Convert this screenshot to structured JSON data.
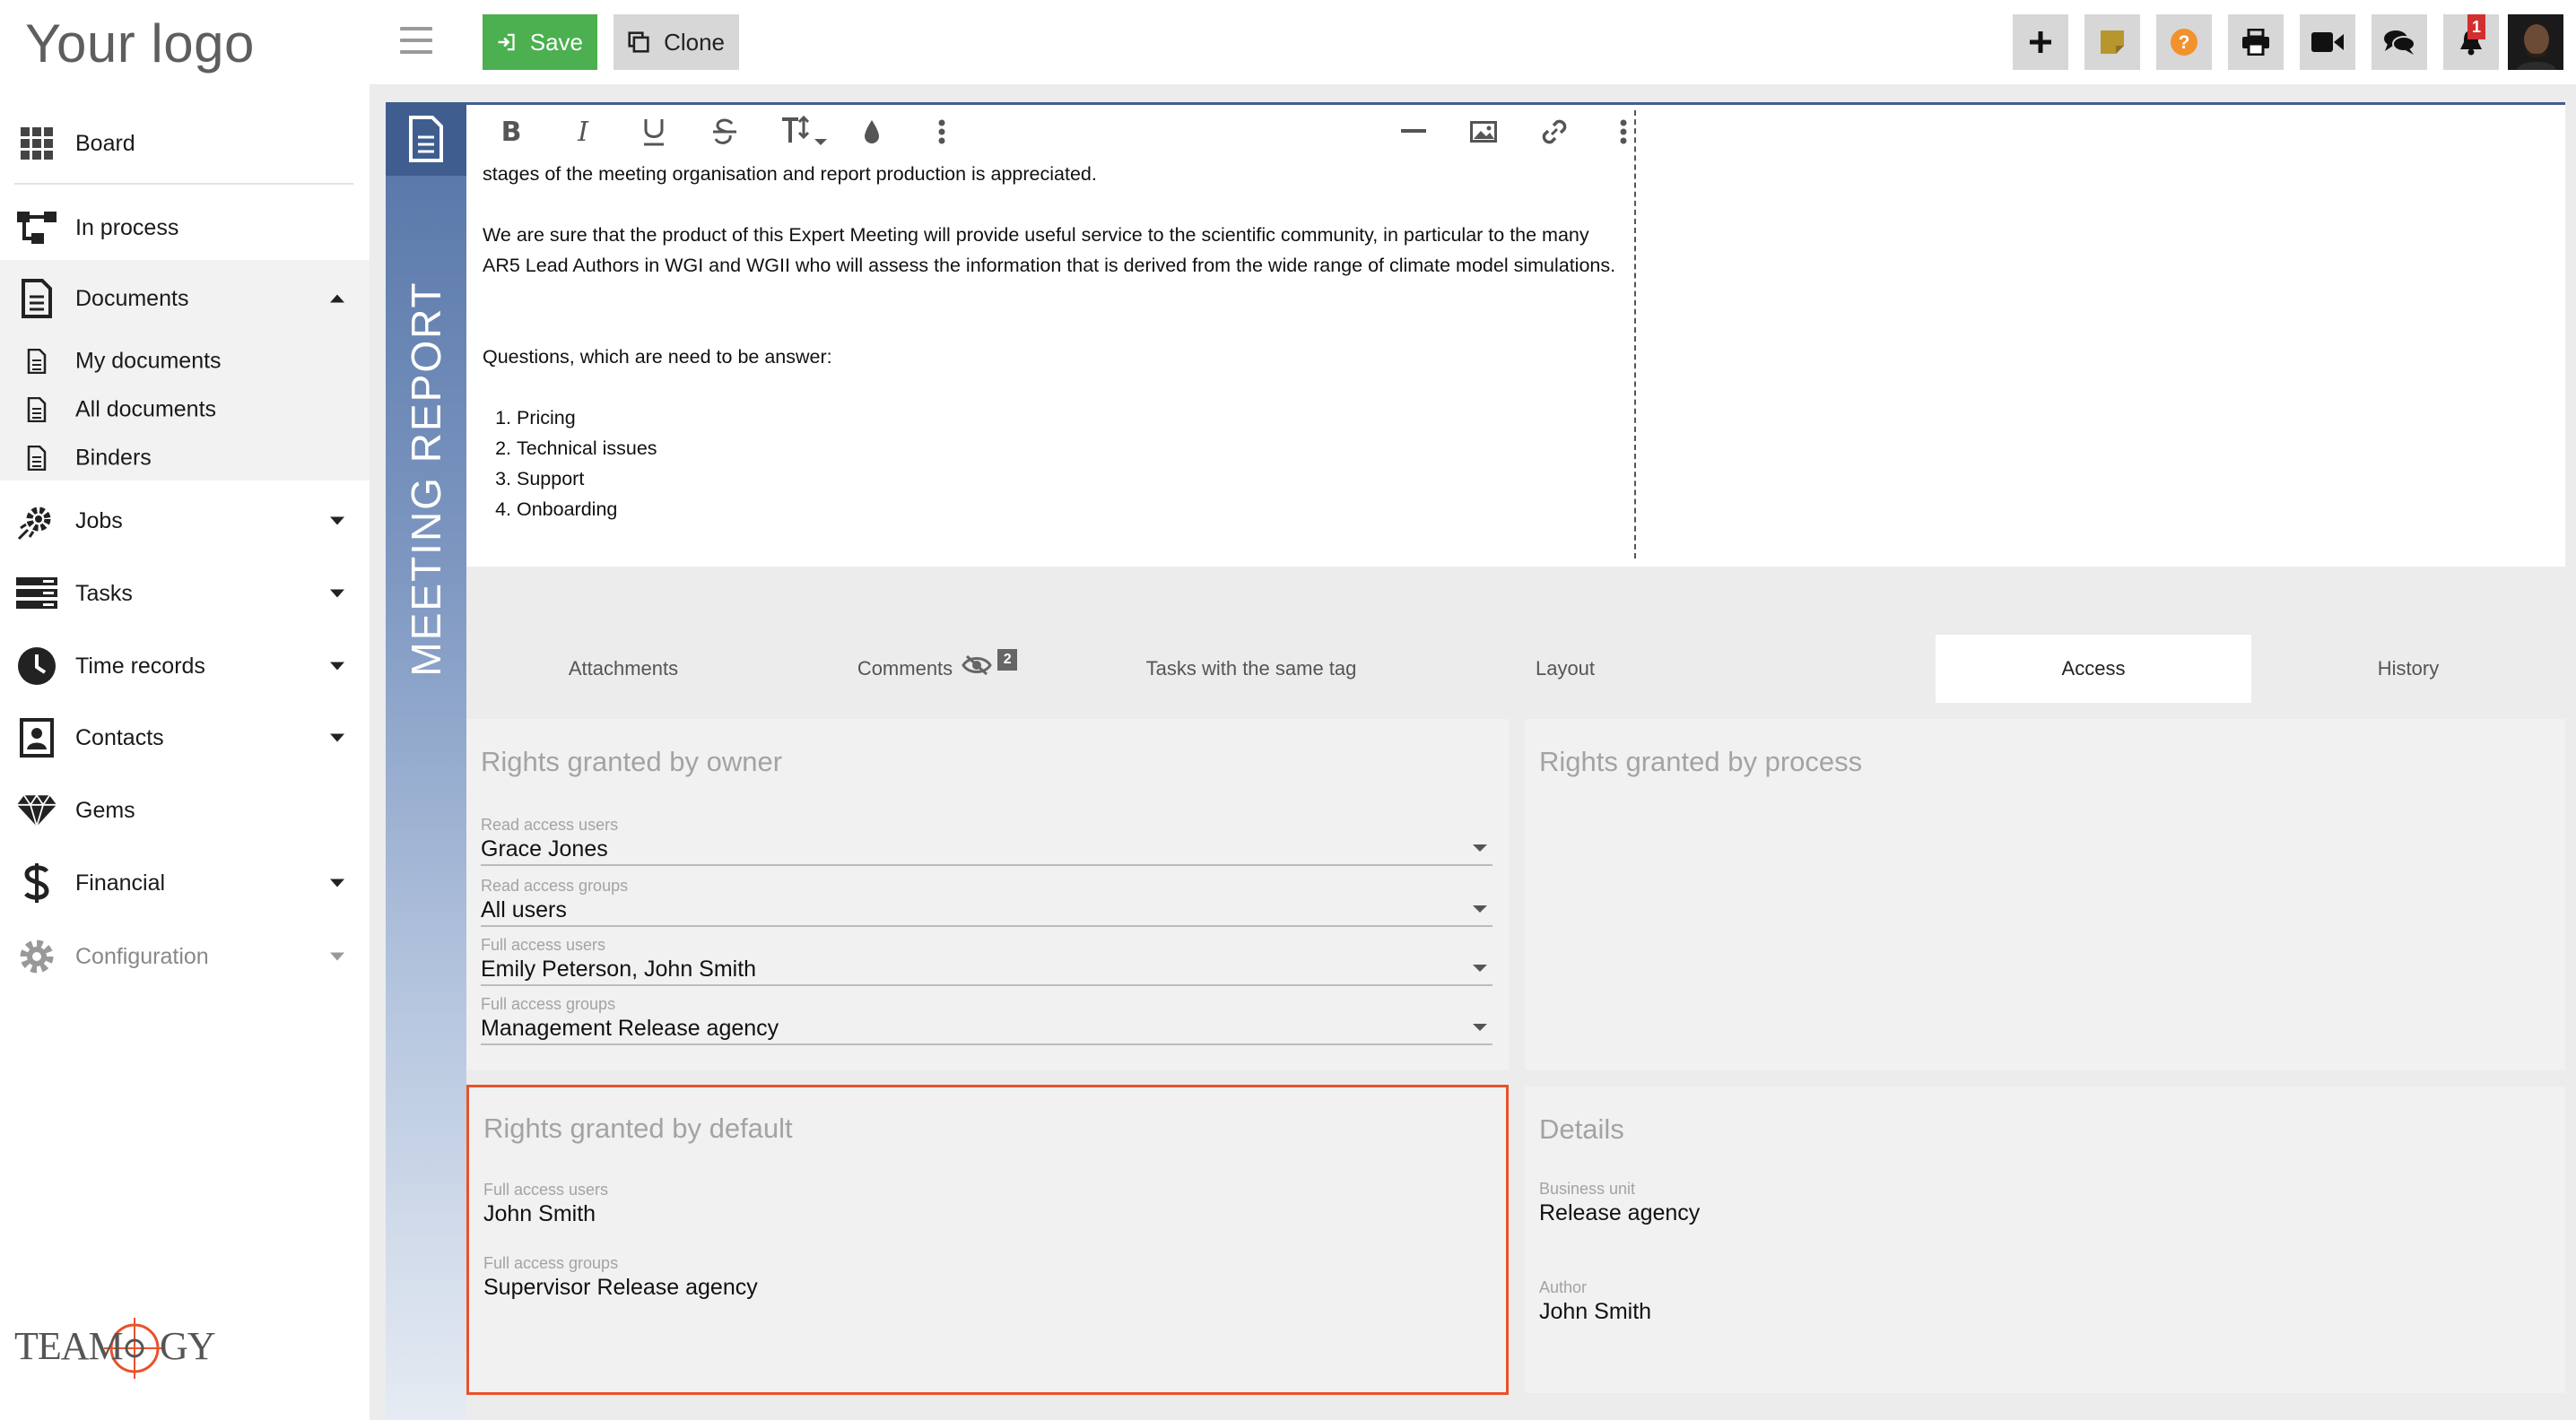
{
  "logo": {
    "text": "Your logo"
  },
  "brand": {
    "text": "TEAMOGY"
  },
  "sidebar": {
    "items": [
      {
        "label": "Board",
        "icon": "grid-icon"
      },
      {
        "label": "In process",
        "icon": "process-flow-icon"
      },
      {
        "label": "Documents",
        "icon": "document-icon",
        "expanded": true
      },
      {
        "label": "Jobs",
        "icon": "jobs-gear-icon"
      },
      {
        "label": "Tasks",
        "icon": "tasks-icon"
      },
      {
        "label": "Time records",
        "icon": "clock-icon"
      },
      {
        "label": "Contacts",
        "icon": "contact-card-icon"
      },
      {
        "label": "Gems",
        "icon": "gem-icon"
      },
      {
        "label": "Financial",
        "icon": "dollar-icon"
      },
      {
        "label": "Configuration",
        "icon": "gear-icon"
      }
    ],
    "document_subitems": [
      {
        "label": "My documents",
        "icon": "document-icon"
      },
      {
        "label": "All documents",
        "icon": "document-icon"
      },
      {
        "label": "Binders",
        "icon": "document-icon"
      }
    ]
  },
  "toolbar": {
    "save_label": "Save",
    "clone_label": "Clone",
    "notification_count": "1",
    "colors": {
      "save": "#4caf50",
      "help": "#f2922c",
      "sticky_note": "#b8962e",
      "badge": "#d32f2f"
    }
  },
  "document": {
    "type_label": "MEETING REPORT",
    "body": {
      "paragraph_1": "stages of the meeting organisation and report production is appreciated.",
      "paragraph_2": "We are sure that the product of this Expert Meeting will provide useful service to the scientific community, in particular to the many AR5 Lead Authors in WGI and WGII who will assess the information that is derived from the wide range of climate model simulations.",
      "paragraph_3": "Questions, which are need to be answer:",
      "list": [
        "Pricing",
        "Technical issues",
        "Support",
        "Onboarding"
      ]
    }
  },
  "tabs": [
    {
      "label": "Attachments"
    },
    {
      "label": "Comments",
      "count": "2"
    },
    {
      "label": "Tasks with the same tag"
    },
    {
      "label": "Layout"
    },
    {
      "label": "Access",
      "active": true
    },
    {
      "label": "History"
    }
  ],
  "access": {
    "owner": {
      "title": "Rights granted by owner",
      "read_users": {
        "label": "Read access users",
        "value": "Grace Jones"
      },
      "read_groups": {
        "label": "Read access groups",
        "value": "All users"
      },
      "full_users": {
        "label": "Full access users",
        "value": "Emily Peterson, John Smith"
      },
      "full_groups": {
        "label": "Full access groups",
        "value": "Management Release agency"
      }
    },
    "process": {
      "title": "Rights granted by process"
    },
    "default": {
      "title": "Rights granted by default",
      "full_users": {
        "label": "Full access users",
        "value": "John Smith"
      },
      "full_groups": {
        "label": "Full access groups",
        "value": "Supervisor Release agency"
      }
    },
    "details": {
      "title": "Details",
      "business_unit": {
        "label": "Business unit",
        "value": "Release agency"
      },
      "author": {
        "label": "Author",
        "value": "John Smith"
      }
    }
  }
}
